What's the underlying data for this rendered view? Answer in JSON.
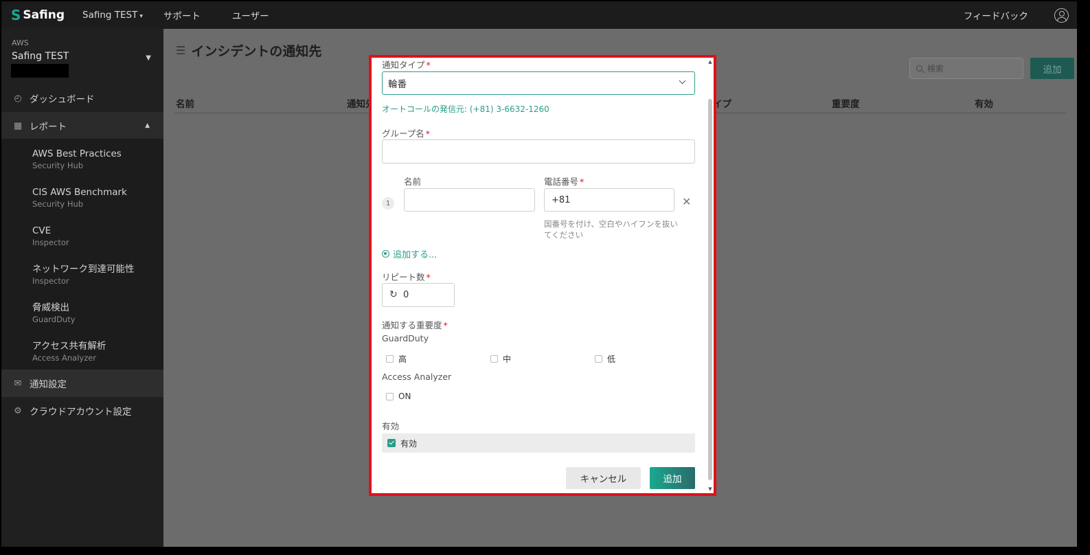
{
  "topbar": {
    "brand": "Safing",
    "tenant": "Safing TEST",
    "nav": [
      "サポート",
      "ユーザー"
    ],
    "feedback": "フィードバック"
  },
  "sidebar": {
    "cloud_label": "AWS",
    "account_name": "Safing TEST",
    "dashboard": "ダッシュボード",
    "reports": "レポート",
    "report_items": [
      {
        "title": "AWS Best Practices",
        "sub": "Security Hub"
      },
      {
        "title": "CIS AWS Benchmark",
        "sub": "Security Hub"
      },
      {
        "title": "CVE",
        "sub": "Inspector"
      },
      {
        "title": "ネットワーク到達可能性",
        "sub": "Inspector"
      },
      {
        "title": "脅威検出",
        "sub": "GuardDuty"
      },
      {
        "title": "アクセス共有解析",
        "sub": "Access Analyzer"
      }
    ],
    "notification_settings": "通知設定",
    "cloud_account_settings": "クラウドアカウント設定"
  },
  "main": {
    "title": "インシデントの通知先",
    "search_placeholder": "検索",
    "add_button": "追加",
    "columns": [
      "名前",
      "通知先",
      "イプ",
      "重要度",
      "有効"
    ]
  },
  "modal": {
    "notify_type_label": "通知タイプ",
    "notify_type_value": "輪番",
    "autocall_note": "オートコールの発信元: (+81) 3-6632-1260",
    "group_name_label": "グループ名",
    "group_name_value": "",
    "member_index": "1",
    "name_label": "名前",
    "name_value": "",
    "phone_label": "電話番号",
    "phone_value": "+81",
    "phone_hint": "国番号を付け、空白やハイフンを抜いてください",
    "add_more": "追加する...",
    "repeat_label": "リピート数",
    "repeat_value": "0",
    "severity_label": "通知する重要度",
    "guardduty_label": "GuardDuty",
    "severities": [
      "高",
      "中",
      "低"
    ],
    "access_analyzer_label": "Access Analyzer",
    "access_analyzer_option": "ON",
    "enabled_label": "有効",
    "enabled_option": "有効",
    "enabled_checked": true,
    "cancel_button": "キャンセル",
    "submit_button": "追加"
  },
  "colors": {
    "accent": "#1aa88e",
    "modal_highlight": "#e0101a"
  }
}
